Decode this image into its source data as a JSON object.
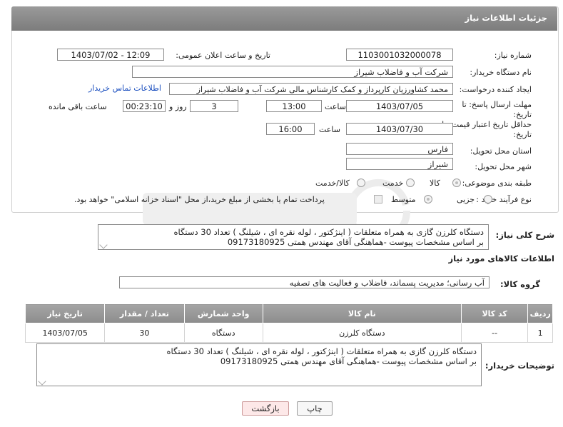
{
  "header": {
    "title": "جزئیات اطلاعات نیاز"
  },
  "form": {
    "need_number_label": "شماره نیاز:",
    "need_number": "1103001032000078",
    "announce_label": "تاریخ و ساعت اعلان عمومی:",
    "announce_value": "1403/07/02 - 12:09",
    "buyer_org_label": "نام دستگاه خریدار:",
    "buyer_org": "شرکت آب و فاضلاب شیراز",
    "creator_label": "ایجاد کننده درخواست:",
    "creator": "محمد کشاورزیان کارپرداز و کمک کارشناس مالی شرکت آب و فاضلاب شیراز",
    "contact_link": "اطلاعات تماس خریدار",
    "deadline_label_1": "مهلت ارسال پاسخ: تا",
    "deadline_label_2": "تاریخ:",
    "deadline_date": "1403/07/05",
    "time_label": "ساعت",
    "deadline_time": "13:00",
    "days_value": "3",
    "days_label": "روز و",
    "remaining_value": "00:23:10",
    "remaining_label": "ساعت باقی مانده",
    "validity_label_1": "حداقل تاریخ اعتبار قیمت: تا",
    "validity_label_2": "تاریخ:",
    "validity_date": "1403/07/30",
    "validity_time_label": "ساعت",
    "validity_time": "16:00",
    "province_label": "استان محل تحویل:",
    "province": "فارس",
    "city_label": "شهر محل تحویل:",
    "city": "شیراز",
    "category_label": "طبقه بندی موضوعی:",
    "category_options": [
      "کالا",
      "خدمت",
      "کالا/خدمت"
    ],
    "process_label": "نوع فرآیند خرید :",
    "process_options": [
      "جزیی",
      "متوسط"
    ],
    "payment_note": "پرداخت تمام یا بخشی از مبلغ خرید،از محل \"اسناد خزانه اسلامی\" خواهد بود."
  },
  "description": {
    "label": "شرح کلی نیاز:",
    "line1": "دستگاه کلرزن گازی به همراه متعلقات ( اینژکتور ، لوله نقره ای ، شیلنگ ) تعداد 30 دستگاه",
    "line2": "بر اساس مشخصات پیوست -هماهنگی آقای مهندس همتی 09173180925"
  },
  "goods": {
    "section_title": "اطلاعات کالاهای مورد نیاز",
    "group_label": "گروه کالا:",
    "group_value": "آب رسانی؛ مدیریت پسماند، فاضلاب و فعالیت های تصفیه",
    "columns": [
      "ردیف",
      "کد کالا",
      "نام کالا",
      "واحد شمارش",
      "تعداد / مقدار",
      "تاریخ نیاز"
    ],
    "rows": [
      {
        "row": "1",
        "code": "--",
        "name": "دستگاه کلرزن",
        "unit": "دستگاه",
        "qty": "30",
        "date": "1403/07/05"
      }
    ]
  },
  "buyer_notes": {
    "label": "توضیحات خریدار:",
    "line1": "دستگاه کلرزن گازی به همراه متعلقات ( اینژکتور ، لوله نقره ای ، شیلنگ ) تعداد 30 دستگاه",
    "line2": "بر اساس مشخصات پیوست -هماهنگی آقای مهندس همتی 09173180925"
  },
  "buttons": {
    "print": "چاپ",
    "back": "بازگشت"
  },
  "colors": {
    "header_bg": "#8a8a8a",
    "link": "#1b4fbf",
    "back_button_bg": "#fde8e8"
  }
}
